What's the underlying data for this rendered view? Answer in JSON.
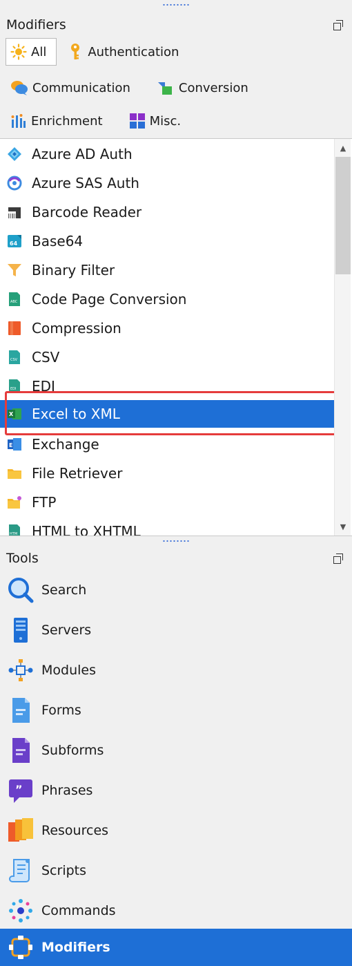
{
  "modifiers_panel": {
    "title": "Modifiers",
    "filters": [
      {
        "label": "All",
        "icon": "sun-icon"
      },
      {
        "label": "Authentication",
        "icon": "key-icon"
      },
      {
        "label": "Communication",
        "icon": "chat-icon"
      },
      {
        "label": "Conversion",
        "icon": "conversion-icon"
      },
      {
        "label": "Enrichment",
        "icon": "enrichment-icon"
      },
      {
        "label": "Misc.",
        "icon": "misc-icon"
      }
    ],
    "items": [
      {
        "label": "Azure AD Auth",
        "icon": "azure-ad-icon"
      },
      {
        "label": "Azure SAS Auth",
        "icon": "azure-sas-icon"
      },
      {
        "label": "Barcode Reader",
        "icon": "barcode-icon"
      },
      {
        "label": "Base64",
        "icon": "base64-icon"
      },
      {
        "label": "Binary Filter",
        "icon": "filter-icon"
      },
      {
        "label": "Code Page Conversion",
        "icon": "code-page-icon"
      },
      {
        "label": "Compression",
        "icon": "compression-icon"
      },
      {
        "label": "CSV",
        "icon": "csv-icon"
      },
      {
        "label": "EDI",
        "icon": "edi-icon"
      },
      {
        "label": "Excel to XML",
        "icon": "excel-icon"
      },
      {
        "label": "Exchange",
        "icon": "exchange-icon"
      },
      {
        "label": "File Retriever",
        "icon": "folder-icon"
      },
      {
        "label": "FTP",
        "icon": "ftp-icon"
      },
      {
        "label": "HTML to XHTML",
        "icon": "html-icon"
      }
    ],
    "selected_item": "Excel to XML"
  },
  "tools_panel": {
    "title": "Tools",
    "items": [
      {
        "label": "Search",
        "icon": "search-icon"
      },
      {
        "label": "Servers",
        "icon": "server-icon"
      },
      {
        "label": "Modules",
        "icon": "modules-icon"
      },
      {
        "label": "Forms",
        "icon": "form-icon"
      },
      {
        "label": "Subforms",
        "icon": "subform-icon"
      },
      {
        "label": "Phrases",
        "icon": "phrases-icon"
      },
      {
        "label": "Resources",
        "icon": "resources-icon"
      },
      {
        "label": "Scripts",
        "icon": "scripts-icon"
      },
      {
        "label": "Commands",
        "icon": "commands-icon"
      },
      {
        "label": "Modifiers",
        "icon": "modifiers-icon"
      }
    ],
    "selected_item": "Modifiers"
  },
  "colors": {
    "selection": "#1e6fd6",
    "highlight_frame": "#e53b3b",
    "panel_bg": "#f0f0f0"
  }
}
